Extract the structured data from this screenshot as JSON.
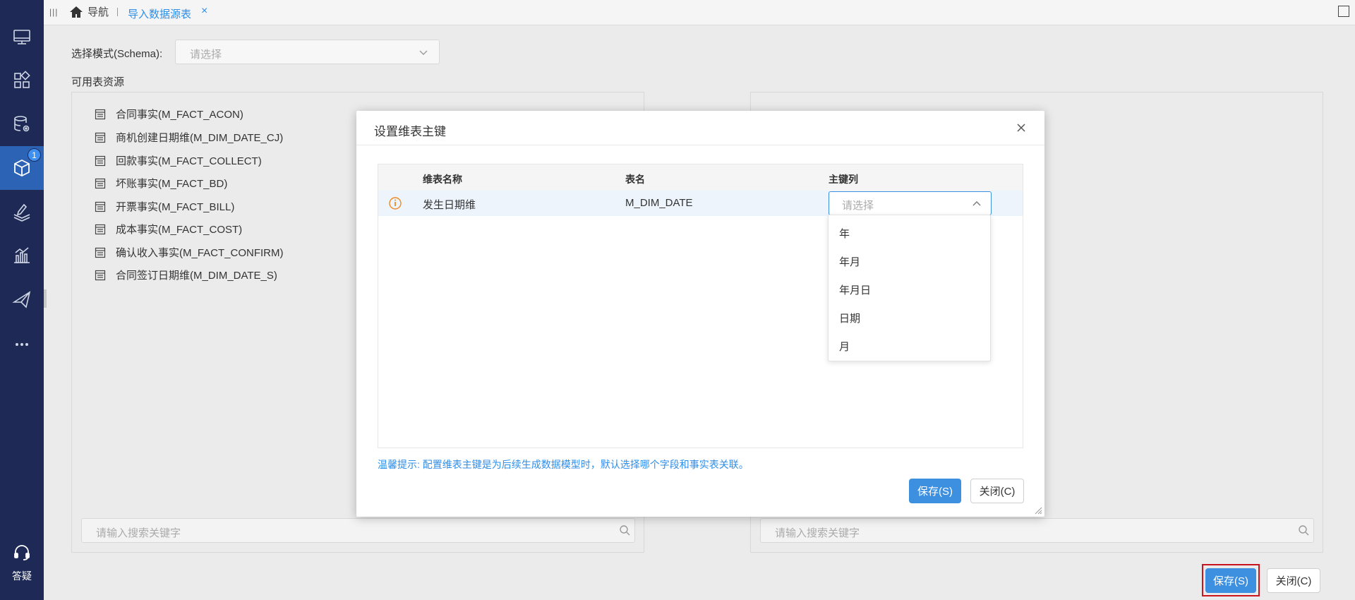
{
  "sidebar": {
    "items": [
      {
        "icon": "monitor-icon"
      },
      {
        "icon": "apps-grid-icon"
      },
      {
        "icon": "database-settings-icon"
      },
      {
        "icon": "cube-icon",
        "active": true,
        "badge": "1"
      },
      {
        "icon": "layers-edit-icon"
      },
      {
        "icon": "bar-chart-icon"
      },
      {
        "icon": "send-icon"
      },
      {
        "icon": "more-icon"
      }
    ],
    "help_label": "答疑",
    "colors": {
      "bg": "#1e2a55",
      "active": "#2d63b5"
    }
  },
  "topbar": {
    "home_label": "导航",
    "tab_label": "导入数据源表",
    "tab_close": "×"
  },
  "main": {
    "schema_label": "选择模式(Schema):",
    "schema_placeholder": "请选择",
    "available_label": "可用表资源",
    "left_list": [
      "合同事实(M_FACT_ACON)",
      "商机创建日期维(M_DIM_DATE_CJ)",
      "回款事实(M_FACT_COLLECT)",
      "坏账事实(M_FACT_BD)",
      "开票事实(M_FACT_BILL)",
      "成本事实(M_FACT_COST)",
      "确认收入事实(M_FACT_CONFIRM)",
      "合同签订日期维(M_DIM_DATE_S)"
    ],
    "search_placeholder_left": "请输入搜索关键字",
    "search_placeholder_right": "请输入搜索关键字",
    "save_label": "保存(S)",
    "close_label": "关闭(C)"
  },
  "modal": {
    "title": "设置维表主键",
    "columns": {
      "dim_name": "维表名称",
      "table_name": "表名",
      "key_col": "主键列"
    },
    "row": {
      "dim_name": "发生日期维",
      "table_name": "M_DIM_DATE",
      "key_placeholder": "请选择"
    },
    "options": [
      "年",
      "年月",
      "年月日",
      "日期",
      "月"
    ],
    "hint": "温馨提示: 配置维表主键是为后续生成数据模型时，默认选择哪个字段和事实表关联。",
    "save_label": "保存(S)",
    "close_label": "关闭(C)",
    "accent": "#3d8fe0"
  }
}
